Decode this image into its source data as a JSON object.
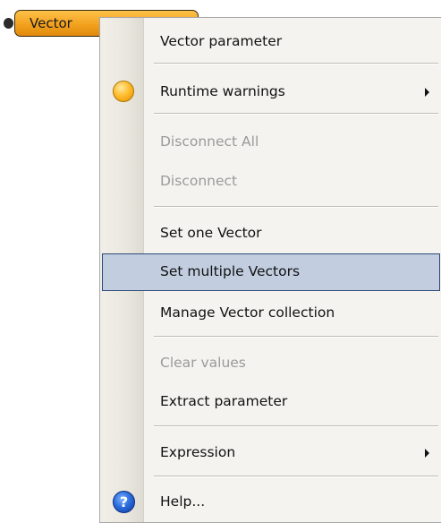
{
  "node": {
    "label": "Vector"
  },
  "menu": {
    "items": [
      {
        "label": "Vector parameter",
        "enabled": true
      },
      {
        "label": "Runtime warnings",
        "enabled": true,
        "icon": "warning-icon",
        "submenu": true
      },
      {
        "label": "Disconnect All",
        "enabled": false
      },
      {
        "label": "Disconnect",
        "enabled": false
      },
      {
        "label": "Set one Vector",
        "enabled": true
      },
      {
        "label": "Set multiple Vectors",
        "enabled": true,
        "highlighted": true
      },
      {
        "label": "Manage Vector collection",
        "enabled": true
      },
      {
        "label": "Clear values",
        "enabled": false
      },
      {
        "label": "Extract parameter",
        "enabled": true
      },
      {
        "label": "Expression",
        "enabled": true,
        "submenu": true
      },
      {
        "label": "Help...",
        "enabled": true,
        "icon": "help-icon"
      }
    ]
  },
  "icons": {
    "help_glyph": "?"
  },
  "colors": {
    "node_fill": "#f2a11e",
    "highlight_fill": "#c2cee0",
    "highlight_border": "#2e4a78",
    "disabled_text": "#9a9a9a"
  }
}
